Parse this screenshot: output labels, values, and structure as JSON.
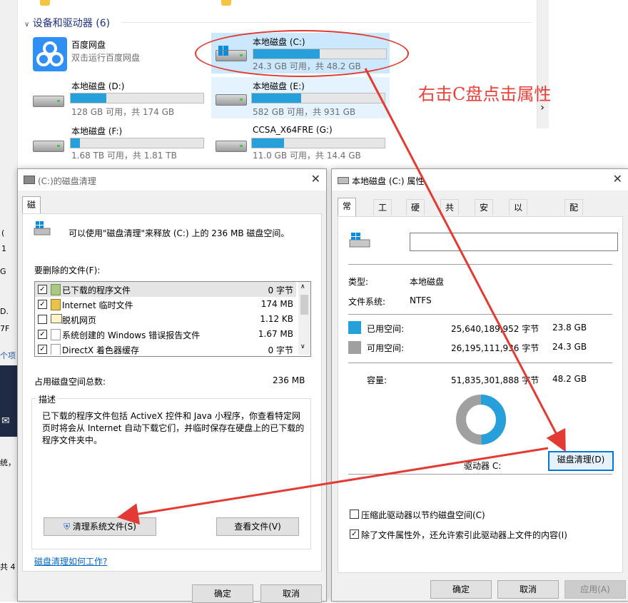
{
  "explorer": {
    "section_title": "设备和驱动器 (6)",
    "drives": [
      {
        "name": "百度网盘",
        "subtitle": "双击运行百度网盘",
        "icon": "baidu-netdisk-icon"
      },
      {
        "name": "本地磁盘 (C:)",
        "free_text": "24.3 GB 可用，共 48.2 GB",
        "used_fraction": 0.5,
        "icon": "windows-drive-icon"
      },
      {
        "name": "本地磁盘 (D:)",
        "free_text": "128 GB 可用，共 174 GB",
        "used_fraction": 0.27,
        "icon": "hard-drive-icon"
      },
      {
        "name": "本地磁盘 (E:)",
        "free_text": "582 GB 可用，共 931 GB",
        "used_fraction": 0.37,
        "icon": "hard-drive-icon"
      },
      {
        "name": "本地磁盘 (F:)",
        "free_text": "1.68 TB 可用，共 1.81 TB",
        "used_fraction": 0.07,
        "icon": "hard-drive-icon"
      },
      {
        "name": "CCSA_X64FRE (G:)",
        "free_text": "11.0 GB 可用，共 14.4 GB",
        "used_fraction": 0.24,
        "icon": "hard-drive-icon"
      }
    ],
    "annotation": "右击C盘点击属性",
    "left_fragments": [
      "(",
      "1",
      "G",
      "D.",
      "7F",
      "个项",
      "统，",
      "共 4"
    ]
  },
  "cleanup_dialog": {
    "title": "(C:)的磁盘清理",
    "tab": "磁盘清理",
    "intro": "可以使用\"磁盘清理\"来释放 (C:) 上的 236 MB 磁盘空间。",
    "files_label": "要删除的文件(F):",
    "files": [
      {
        "name": "已下载的程序文件",
        "size": "0 字节",
        "checked": true,
        "selected": true
      },
      {
        "name": "Internet 临时文件",
        "size": "174 MB",
        "checked": true
      },
      {
        "name": "脱机网页",
        "size": "1.12 KB",
        "checked": false
      },
      {
        "name": "系统创建的 Windows 错误报告文件",
        "size": "1.67 MB",
        "checked": true
      },
      {
        "name": "DirectX 着色器缓存",
        "size": "0 字节",
        "checked": true
      }
    ],
    "total_label": "占用磁盘空间总数:",
    "total_value": "236 MB",
    "desc_legend": "描述",
    "desc_text": "已下载的程序文件包括 ActiveX 控件和 Java 小程序，你查看特定网页时将会从 Internet 自动下载它们，并临时保存在硬盘上的已下载的程序文件夹中。",
    "clean_system_button": "清理系统文件(S)",
    "view_files_button": "查看文件(V)",
    "help_link": "磁盘清理如何工作?",
    "ok_button": "确定",
    "cancel_button": "取消"
  },
  "props_dialog": {
    "title": "本地磁盘 (C:) 属性",
    "tabs": [
      "常规",
      "工具",
      "硬件",
      "共享",
      "安全",
      "以前的版本",
      "配额"
    ],
    "label_input_value": "",
    "type_label": "类型:",
    "type_value": "本地磁盘",
    "fs_label": "文件系统:",
    "fs_value": "NTFS",
    "used_label": "已用空间:",
    "used_bytes": "25,640,189,952 字节",
    "used_gb": "23.8 GB",
    "free_label": "可用空间:",
    "free_bytes": "26,195,111,936 字节",
    "free_gb": "24.3 GB",
    "cap_label": "容量:",
    "cap_bytes": "51,835,301,888 字节",
    "cap_gb": "48.2 GB",
    "used_fraction": 0.495,
    "drive_label": "驱动器 C:",
    "cleanup_button": "磁盘清理(D)",
    "compress_label": "压缩此驱动器以节约磁盘空间(C)",
    "compress_checked": false,
    "index_label": "除了文件属性外，还允许索引此驱动器上文件的内容(I)",
    "index_checked": true,
    "ok_button": "确定",
    "cancel_button": "取消",
    "apply_button": "应用(A)"
  },
  "colors": {
    "used": "#26a0da",
    "free": "#a0a0a0",
    "annotation": "#e8423a",
    "accent": "#0078d7"
  }
}
